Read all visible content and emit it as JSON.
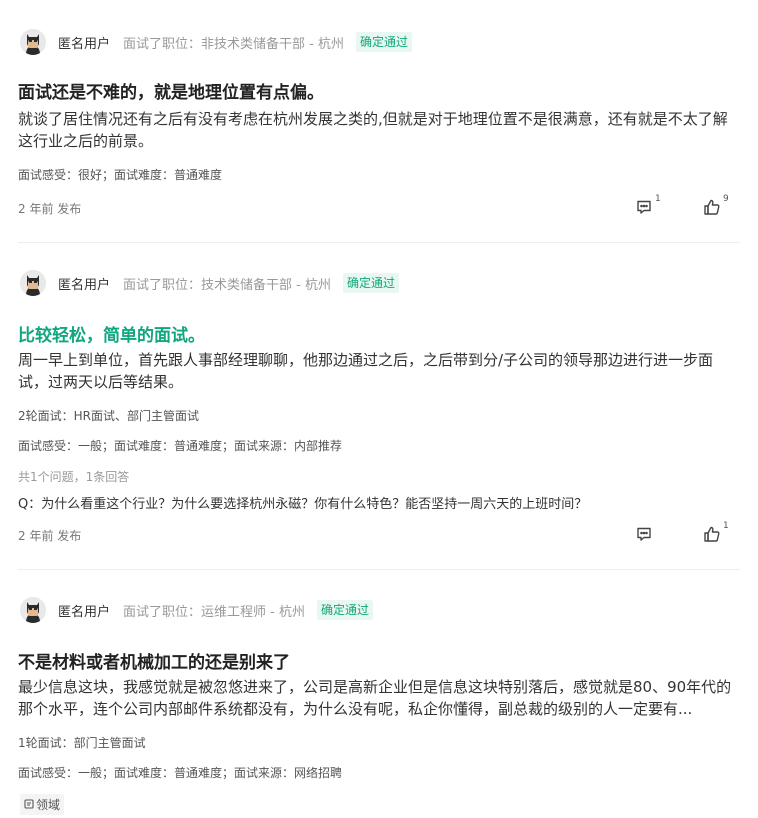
{
  "posts": [
    {
      "username": "匿名用户",
      "position": "面试了职位：非技术类储备干部 - 杭州",
      "badge": "确定通过",
      "title": "面试还是不难的，就是地理位置有点偏。",
      "title_color": "#222222",
      "body": "就谈了居住情况还有之后有没有考虑在杭州发展之类的,但就是对于地理位置不是很满意，还有就是不太了解这行业之后的前景。",
      "feeling": "面试感受：很好；面试难度：普通难度",
      "time": "2 年前 发布",
      "comment_count": "1",
      "like_count": "9"
    },
    {
      "username": "匿名用户",
      "position": "面试了职位：技术类储备干部 - 杭州",
      "badge": "确定通过",
      "title": "比较轻松，简单的面试。",
      "title_color": "#10a680",
      "body": "周一早上到单位，首先跟人事部经理聊聊，他那边通过之后，之后带到分/子公司的领导那边进行进一步面试，过两天以后等结果。",
      "rounds": "2轮面试：HR面试、部门主管面试",
      "feeling": "面试感受：一般；面试难度：普通难度；面试来源：内部推荐",
      "qa_count": "共1个问题，1条回答",
      "question": "Q：为什么看重这个行业？为什么要选择杭州永磁？你有什么特色？能否坚持一周六天的上班时间？",
      "time": "2 年前 发布",
      "comment_count": "",
      "like_count": "1"
    },
    {
      "username": "匿名用户",
      "position": "面试了职位：运维工程师 - 杭州",
      "badge": "确定通过",
      "title": "不是材料或者机械加工的还是别来了",
      "title_color": "#222222",
      "body": "最少信息这块，我感觉就是被忽悠进来了，公司是高新企业但是信息这块特别落后，感觉就是80、90年代的那个水平，连个公司内部邮件系统都没有，为什么没有呢，私企你懂得，副总裁的级别的人一定要有...",
      "rounds": "1轮面试：部门主管面试",
      "feeling": "面试感受：一般；面试难度：普通难度；面试来源：网络招聘",
      "tag": "领域"
    }
  ],
  "icons": {
    "avatar": "anonymous-avatar-icon",
    "comment": "comment-icon",
    "like": "thumbs-up-icon",
    "tag": "tag-icon"
  },
  "colors": {
    "accent_green": "#10a680",
    "badge_bg": "#e8f7f1",
    "badge_text": "#12a77a"
  }
}
